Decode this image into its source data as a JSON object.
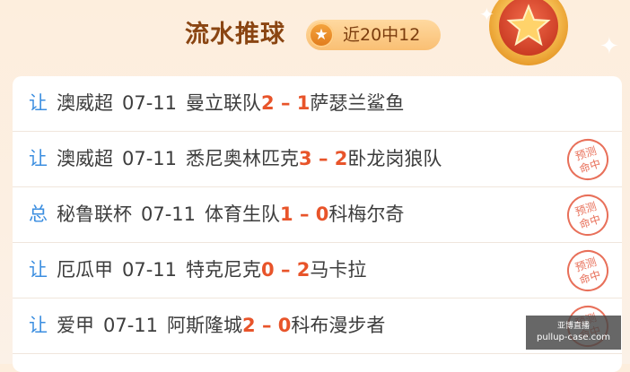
{
  "header": {
    "title": "流水推球",
    "record": "近20中12",
    "star_icon": "★"
  },
  "rows": [
    {
      "tag": "让",
      "league": "澳威超",
      "date": "07-11",
      "home": "曼立联队",
      "home_score": "2",
      "sep": " – ",
      "away_score": "1",
      "away": "萨瑟兰鲨鱼",
      "hit": false
    },
    {
      "tag": "让",
      "league": "澳威超",
      "date": "07-11",
      "home": "悉尼奥林匹克",
      "home_score": "3",
      "sep": " – ",
      "away_score": "2",
      "away": "卧龙岗狼队",
      "hit": true
    },
    {
      "tag": "总",
      "league": "秘鲁联杯",
      "date": "07-11",
      "home": "体育生队",
      "home_score": "1",
      "sep": " – ",
      "away_score": "0",
      "away": "科梅尔奇",
      "hit": true
    },
    {
      "tag": "让",
      "league": "厄瓜甲",
      "date": "07-11",
      "home": "特克尼克",
      "home_score": "0",
      "sep": " – ",
      "away_score": "2",
      "away": "马卡拉",
      "hit": true
    },
    {
      "tag": "让",
      "league": "爱甲",
      "date": "07-11",
      "home": "阿斯隆城",
      "home_score": "2",
      "sep": " – ",
      "away_score": "0",
      "away": "科布漫步者",
      "hit": true
    }
  ],
  "stamp": {
    "line1": "预测",
    "line2": "命中",
    "color": "#e8705a"
  },
  "watermark": {
    "line1": "亚博直播",
    "line2": "pullup-case.com"
  },
  "colors": {
    "title": "#8a4512",
    "tag": "#3b8ee0",
    "score": "#e8542a",
    "text": "#3d3d3d"
  }
}
